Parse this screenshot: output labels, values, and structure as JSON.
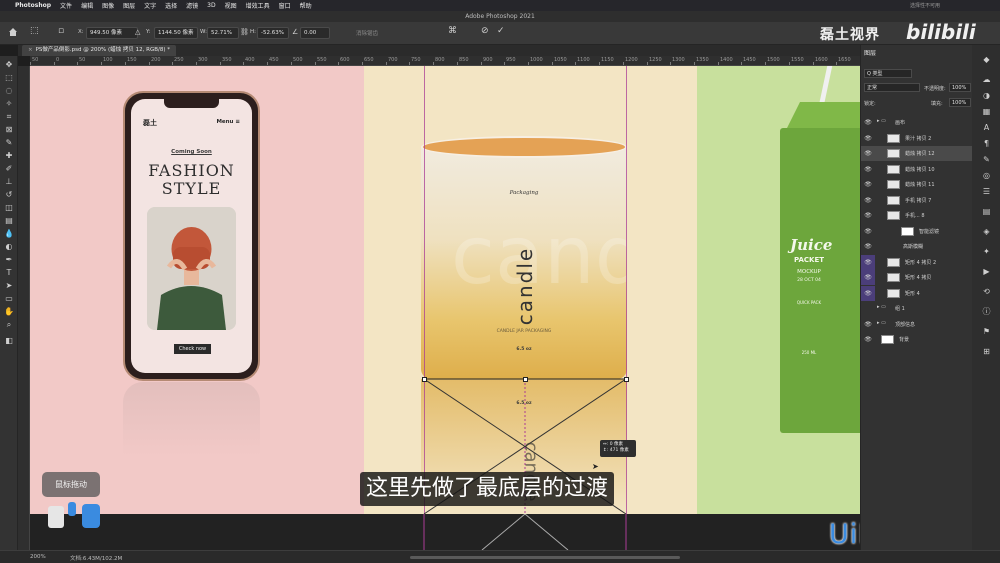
{
  "menubar": {
    "app_name": "Photoshop",
    "items": [
      "文件",
      "编辑",
      "图像",
      "图层",
      "文字",
      "选择",
      "滤镜",
      "3D",
      "视图",
      "增效工具",
      "窗口",
      "帮助"
    ],
    "status_right": "选择性不可用"
  },
  "window": {
    "title": "Adobe Photoshop 2021"
  },
  "options": {
    "x_label": "X:",
    "x_value": "949.50 像素",
    "y_label": "Y:",
    "y_value": "1144.50 像素",
    "w_label": "W:",
    "w_value": "52.71%",
    "h_label": "H:",
    "h_value": "-52.63%",
    "angle_value": "0.00",
    "interp_label": "消除锯齿"
  },
  "document_tab": {
    "close": "×",
    "label": "PS做产品倒影.psd @ 200% (蜡烛 拷贝 12, RGB/8) *"
  },
  "ruler": {
    "ticks": [
      "50",
      "0",
      "50",
      "100",
      "150",
      "200",
      "250",
      "300",
      "350",
      "400",
      "450",
      "500",
      "550",
      "600",
      "650",
      "700",
      "750",
      "800",
      "850",
      "900",
      "950",
      "1000",
      "1050",
      "1100",
      "1150",
      "1200",
      "1250",
      "1300",
      "1350",
      "1400",
      "1450",
      "1500",
      "1550",
      "1600",
      "1650"
    ]
  },
  "phone": {
    "brand": "磊土",
    "menu": "Menu ≡",
    "coming": "Coming Soon",
    "title_line1": "FASHION",
    "title_line2": "STYLE",
    "button": "Check now"
  },
  "candle": {
    "logo": "Packaging",
    "word": "candle",
    "ghost": "candle",
    "sub1": "CANDLE JAR PACKAGING",
    "sub2": "6.5 oz",
    "reflection_sub": "6.5 oz",
    "reflection_word": "candle"
  },
  "transform_info": {
    "line1": "↔:   0 像素",
    "line2": "↕: 471 像素"
  },
  "juice": {
    "line1": "Juice",
    "line2": "PACKET",
    "line3": "MOCKUP",
    "line4": "28 OCT 04",
    "line5": "QUICK PACK",
    "line6": "250 ML"
  },
  "subtitle": "这里先做了最底层的过渡",
  "overlay": {
    "mouse_drag": "鼠标拖动"
  },
  "watermarks": {
    "channel": "磊土视界",
    "bili": "bilibili",
    "site": "UiBQ.CoM"
  },
  "statusbar": {
    "zoom": "200%",
    "doc": "文档:6.43M/102.2M"
  },
  "layers": {
    "tab": "图层",
    "kind": "Q 类型",
    "blend": "正常",
    "opacity_label": "不透明度:",
    "opacity": "100%",
    "lock_label": "锁定:",
    "fill_label": "填充:",
    "fill": "100%",
    "rows": [
      {
        "name": "画布",
        "visible": "👁",
        "type": "group"
      },
      {
        "name": "果汁 拷贝 2",
        "visible": "👁",
        "type": "layer"
      },
      {
        "name": "蜡烛 拷贝 12",
        "visible": "👁",
        "type": "layer",
        "selected": true
      },
      {
        "name": "蜡烛 拷贝 10",
        "visible": "👁",
        "type": "layer"
      },
      {
        "name": "蜡烛 拷贝 11",
        "visible": "👁",
        "type": "layer"
      },
      {
        "name": "手机 拷贝 7",
        "visible": "👁",
        "type": "layer"
      },
      {
        "name": "手机... 8",
        "visible": "👁",
        "type": "smart"
      },
      {
        "name": "智能滤镜",
        "visible": "👁",
        "type": "filter"
      },
      {
        "name": "高斯模糊",
        "visible": "👁",
        "type": "effect"
      },
      {
        "name": "矩形 4 拷贝 2",
        "visible": "👁",
        "type": "shape",
        "purple": true
      },
      {
        "name": "矩形 4 拷贝",
        "visible": "👁",
        "type": "shape",
        "purple": true
      },
      {
        "name": "矩形 4",
        "visible": "👁",
        "type": "shape",
        "purple": true
      },
      {
        "name": "组 1",
        "visible": "",
        "type": "group"
      },
      {
        "name": "顶部信息",
        "visible": "👁",
        "type": "group"
      },
      {
        "name": "背景",
        "visible": "👁",
        "type": "background"
      }
    ]
  },
  "colors": {
    "pink_panel": "#f2c9c7",
    "cream_panel": "#f3e5c4",
    "green_panel": "#c8e09d",
    "guide": "#aa3c96",
    "accent_blue": "#3a8be0"
  }
}
